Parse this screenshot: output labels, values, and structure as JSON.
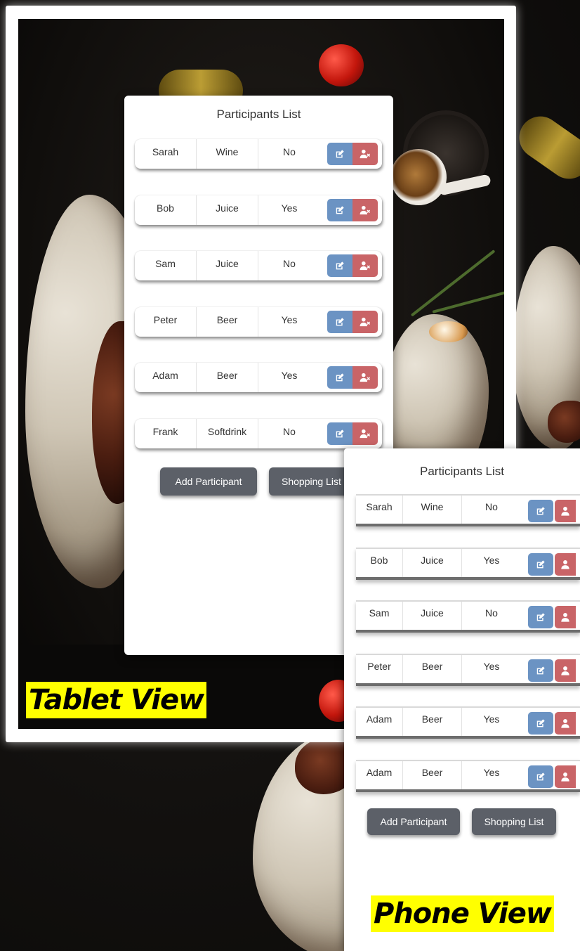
{
  "tablet": {
    "title": "Participants List",
    "participants": [
      {
        "name": "Sarah",
        "drink": "Wine",
        "attending": "No"
      },
      {
        "name": "Bob",
        "drink": "Juice",
        "attending": "Yes"
      },
      {
        "name": "Sam",
        "drink": "Juice",
        "attending": "No"
      },
      {
        "name": "Peter",
        "drink": "Beer",
        "attending": "Yes"
      },
      {
        "name": "Adam",
        "drink": "Beer",
        "attending": "Yes"
      },
      {
        "name": "Frank",
        "drink": "Softdrink",
        "attending": "No"
      }
    ],
    "add_button": "Add Participant",
    "shopping_button": "Shopping List",
    "view_label": "Tablet View"
  },
  "phone": {
    "title": "Participants List",
    "participants": [
      {
        "name": "Sarah",
        "drink": "Wine",
        "attending": "No"
      },
      {
        "name": "Bob",
        "drink": "Juice",
        "attending": "Yes"
      },
      {
        "name": "Sam",
        "drink": "Juice",
        "attending": "No"
      },
      {
        "name": "Peter",
        "drink": "Beer",
        "attending": "Yes"
      },
      {
        "name": "Adam",
        "drink": "Beer",
        "attending": "Yes"
      },
      {
        "name": "Adam",
        "drink": "Beer",
        "attending": "Yes"
      }
    ],
    "add_button": "Add Participant",
    "shopping_button": "Shopping List",
    "view_label": "Phone View"
  },
  "icons": {
    "edit": "edit-icon",
    "remove": "remove-user-icon"
  },
  "colors": {
    "edit_button": "#6b93c3",
    "remove_button": "#c96467",
    "action_button": "#5c6068",
    "label_highlight": "#ffff00"
  }
}
